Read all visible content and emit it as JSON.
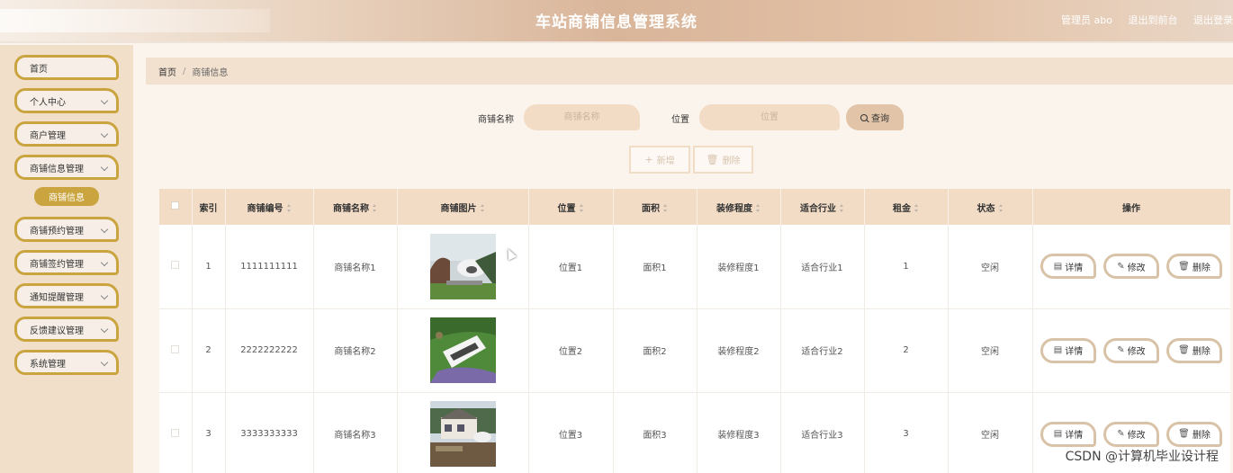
{
  "header": {
    "title": "车站商铺信息管理系统",
    "admin_label": "管理员 abo",
    "front_link": "退出到前台",
    "logout_link": "退出登录"
  },
  "sidebar": {
    "items": [
      {
        "label": "首页"
      },
      {
        "label": "个人中心"
      },
      {
        "label": "商户管理"
      },
      {
        "label": "商铺信息管理"
      },
      {
        "label": "商铺预约管理"
      },
      {
        "label": "商铺签约管理"
      },
      {
        "label": "通知提醒管理"
      },
      {
        "label": "反馈建议管理"
      },
      {
        "label": "系统管理"
      }
    ],
    "active_sub": "商铺信息"
  },
  "breadcrumb": {
    "home": "首页",
    "current": "商铺信息"
  },
  "search": {
    "name_label": "商铺名称",
    "name_placeholder": "商铺名称",
    "name_value": "",
    "location_label": "位置",
    "location_placeholder": "位置",
    "location_value": "",
    "query_label": "查询"
  },
  "toolbar": {
    "add_label": "新增",
    "delete_label": "删除"
  },
  "table": {
    "headers": [
      "索引",
      "商铺编号",
      "商铺名称",
      "商铺图片",
      "位置",
      "面积",
      "装修程度",
      "适合行业",
      "租金",
      "状态",
      "操作"
    ],
    "rows": [
      {
        "index": "1",
        "code": "1111111111",
        "name": "商铺名称1",
        "location": "位置1",
        "area": "面积1",
        "decoration": "装修程度1",
        "industry": "适合行业1",
        "rent": "1",
        "status": "空闲"
      },
      {
        "index": "2",
        "code": "2222222222",
        "name": "商铺名称2",
        "location": "位置2",
        "area": "面积2",
        "decoration": "装修程度2",
        "industry": "适合行业2",
        "rent": "2",
        "status": "空闲"
      },
      {
        "index": "3",
        "code": "3333333333",
        "name": "商铺名称3",
        "location": "位置3",
        "area": "面积3",
        "decoration": "装修程度3",
        "industry": "适合行业3",
        "rent": "3",
        "status": "空闲"
      }
    ],
    "ops": {
      "detail": "详情",
      "edit": "修改",
      "delete": "删除"
    }
  },
  "watermark": "CSDN @计算机毕业设计程"
}
